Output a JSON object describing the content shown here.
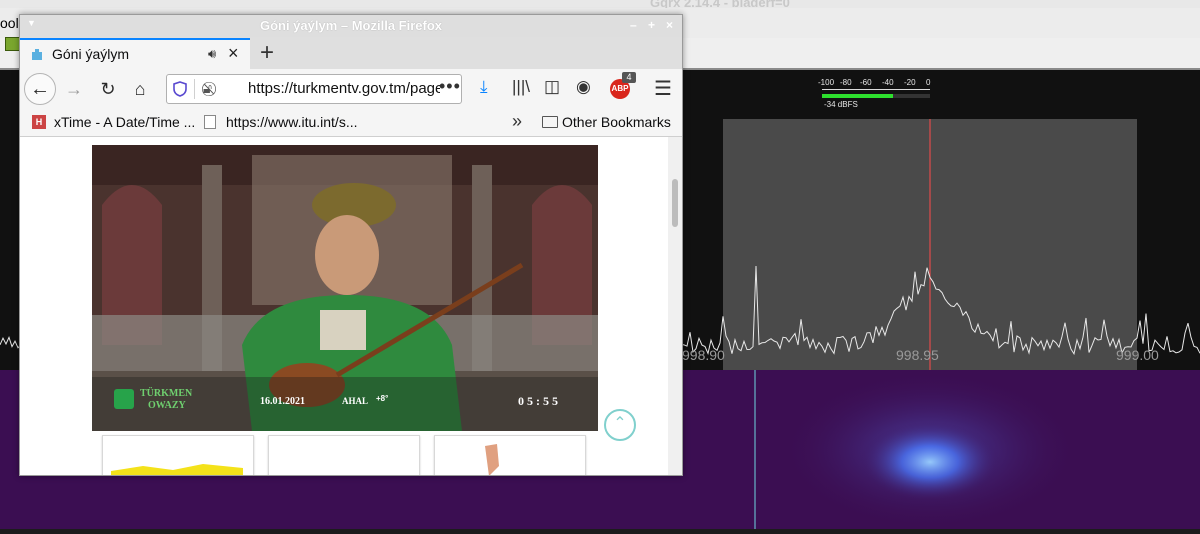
{
  "gqrx": {
    "title": "Gqrx 2.14.4 - bladerf=0",
    "menu_fragment": "ool",
    "meter": {
      "ticks": [
        "-100",
        "-80",
        "-60",
        "-40",
        "-20",
        "0"
      ],
      "level_label": "-34 dBFS",
      "level_fraction": 0.66
    },
    "freq_labels": [
      "998.90",
      "998.95",
      "999.00"
    ],
    "accent_colors": {
      "waterfall": "#3b0e52",
      "signal": "#6aa8ff",
      "meter": "#2ee02e",
      "center_marker": "#ff4a4a"
    }
  },
  "firefox": {
    "window_title": "Góni ýaýlym – Mozilla Firefox",
    "tab": {
      "title": "Góni ýaýlym",
      "audio_icon": "speaker-icon",
      "close_icon": "close-icon"
    },
    "new_tab_label": "+",
    "nav": {
      "back": "←",
      "forward": "→",
      "reload": "↻",
      "home": "⌂"
    },
    "url": "https://turkmentv.gov.tm/page",
    "page_actions": "•••",
    "abp_label": "ABP",
    "abp_badge": "4",
    "menu": "☰",
    "bookmarks": [
      {
        "label": "xTime - A Date/Time ...",
        "icon_text": "H"
      },
      {
        "label": "https://www.itu.int/s...",
        "icon_text": ""
      }
    ],
    "bookmarks_overflow": "»",
    "other_bookmarks": "Other Bookmarks"
  },
  "video": {
    "channel_line1": "TÜRKMEN",
    "channel_line2": "OWAZY",
    "date": "16.01.2021",
    "region": "AHAL",
    "temperature": "+8°",
    "clock": "05:55"
  },
  "scroll_top_label": "⌃"
}
